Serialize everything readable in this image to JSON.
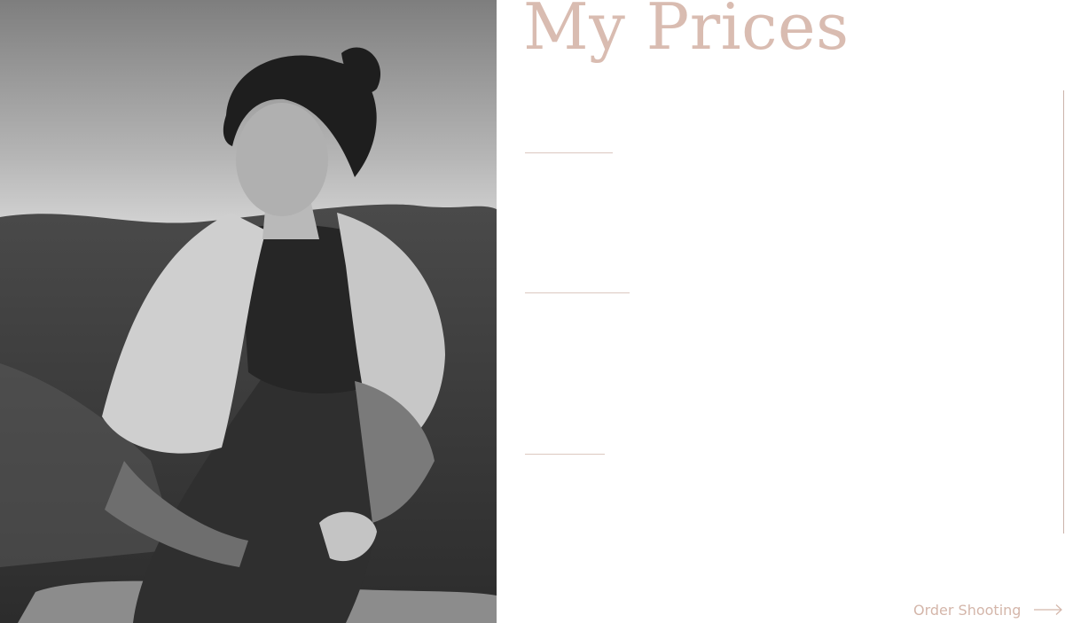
{
  "header": {
    "title": "My Prices"
  },
  "photo": {
    "alt_icon": "portrait-photo"
  },
  "cta": {
    "label": "Order Shooting",
    "icon": "arrow-right-icon"
  },
  "colors": {
    "accent": "#d9bcb1",
    "divider": "#dcc8c0",
    "background": "#ffffff"
  }
}
